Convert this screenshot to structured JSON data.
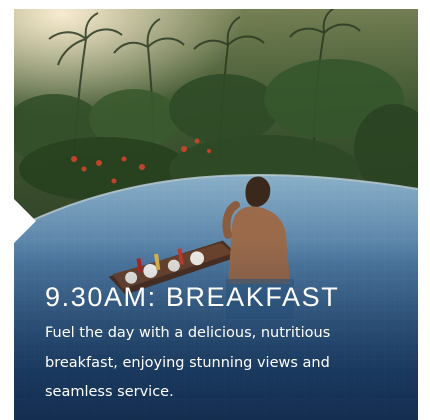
{
  "card": {
    "title": "9.30AM: BREAKFAST",
    "description": "Fuel the day with a delicious, nutritious breakfast, enjoying stunning views and seamless service."
  },
  "photo": {
    "subject": "floating breakfast tray in infinity pool with jungle view",
    "icon": "photo-image"
  },
  "colors": {
    "pool_blue": "#2f5f8e",
    "pool_deep": "#1e3f6a",
    "jungle_green": "#2c4a24",
    "flowers": "#c9452a",
    "text": "#ffffff"
  }
}
